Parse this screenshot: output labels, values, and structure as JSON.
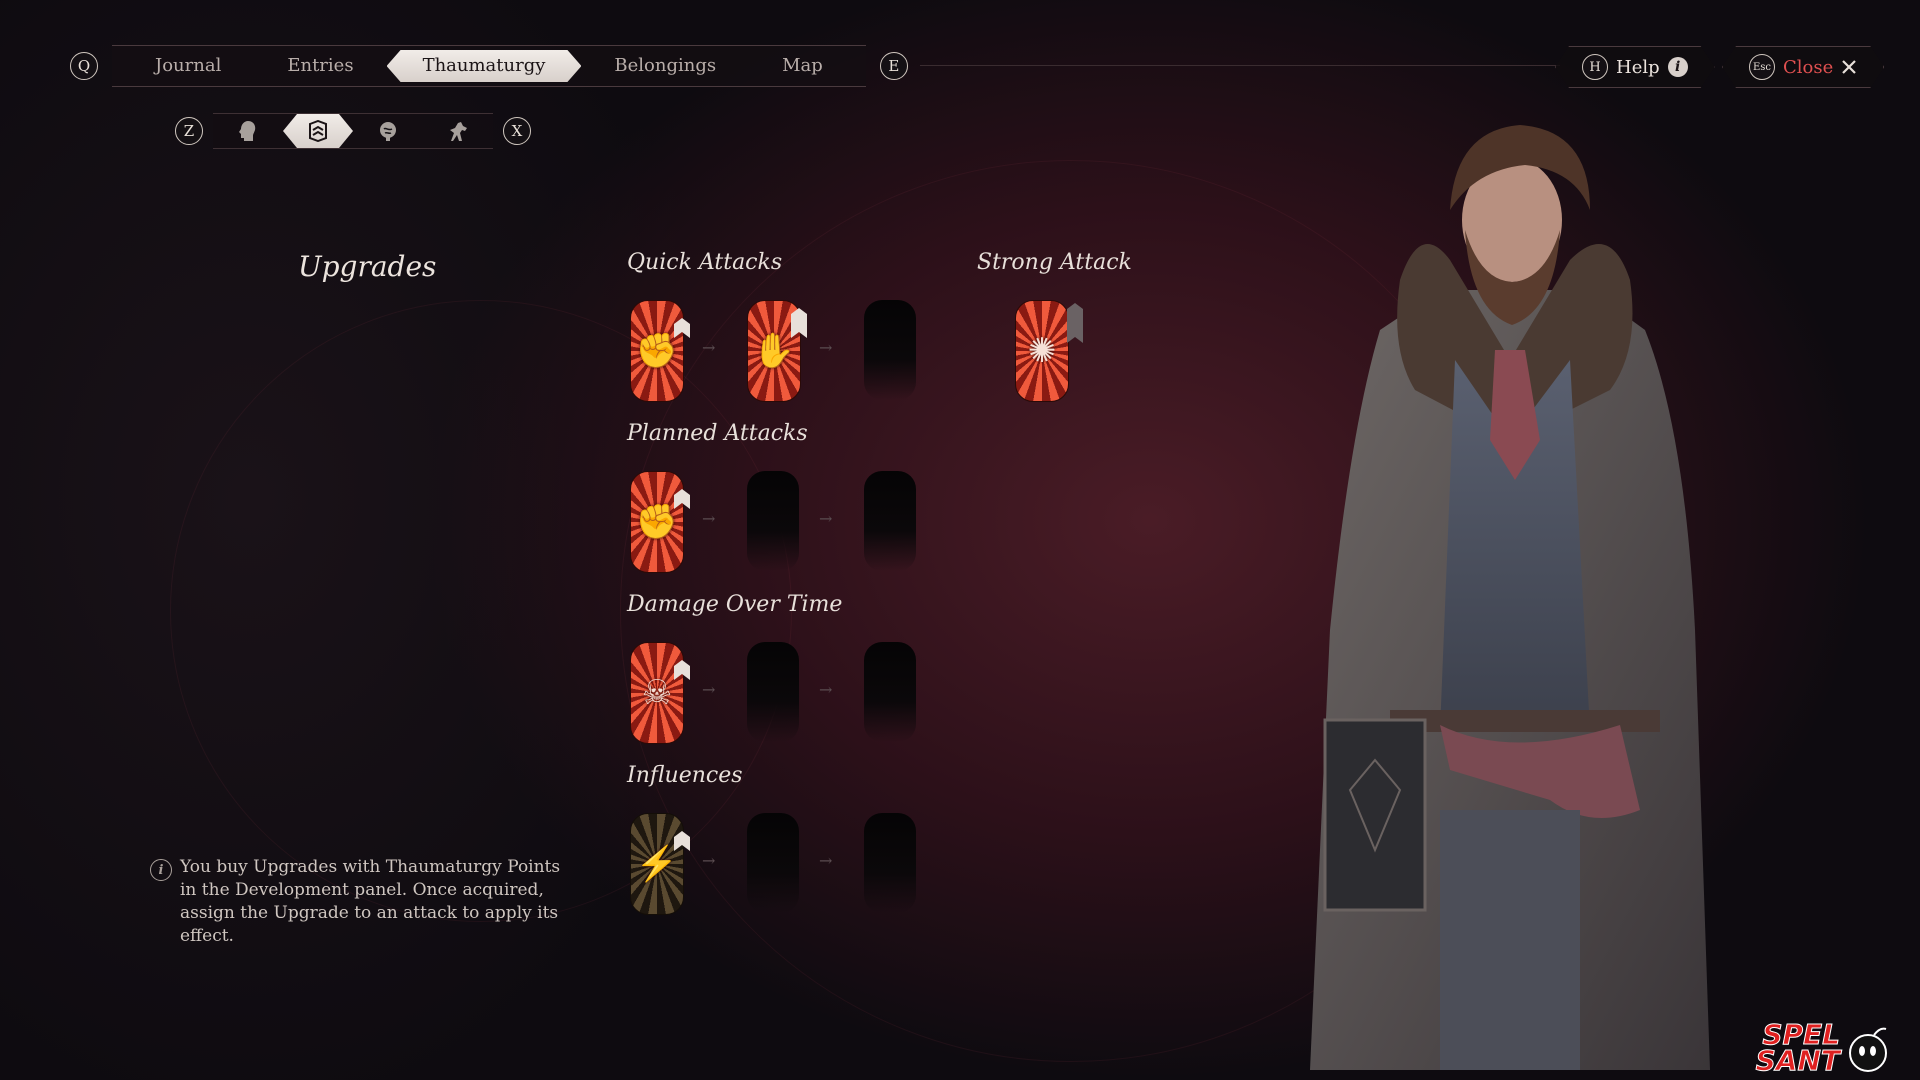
{
  "nav": {
    "prev_key": "Q",
    "next_key": "E",
    "tabs": [
      {
        "label": "Journal"
      },
      {
        "label": "Entries"
      },
      {
        "label": "Thaumaturgy",
        "active": true
      },
      {
        "label": "Belongings"
      },
      {
        "label": "Map"
      }
    ]
  },
  "subnav": {
    "prev_key": "Z",
    "next_key": "X",
    "icons": [
      "head-icon",
      "upgrades-icon",
      "brain-icon",
      "horse-icon"
    ],
    "active_index": 1
  },
  "help": {
    "key": "H",
    "label": "Help"
  },
  "close": {
    "key": "Esc",
    "label": "Close"
  },
  "upgrades_title": "Upgrades",
  "sections": {
    "quick": {
      "title": "Quick Attacks",
      "slots": [
        "fist-icon",
        "hand-icon",
        "empty"
      ]
    },
    "strong": {
      "title": "Strong Attack",
      "slots": [
        "brain-icon"
      ]
    },
    "planned": {
      "title": "Planned Attacks",
      "slots": [
        "raised-fist-icon",
        "empty",
        "empty"
      ]
    },
    "dot": {
      "title": "Damage Over Time",
      "slots": [
        "skull-hand-icon",
        "empty",
        "empty"
      ]
    },
    "influences": {
      "title": "Influences",
      "slots": [
        "lightning-head-icon",
        "empty",
        "empty"
      ]
    }
  },
  "info_note": "You buy Upgrades with Thaumaturgy Points in the Development panel. Once acquired, assign the Upgrade to an attack to apply its effect.",
  "watermark": {
    "line1": "SPEL",
    "line2": "SANT"
  },
  "colors": {
    "close_accent": "#e05050",
    "card_red": "#f05a3c",
    "card_gold": "#5a4a30"
  }
}
